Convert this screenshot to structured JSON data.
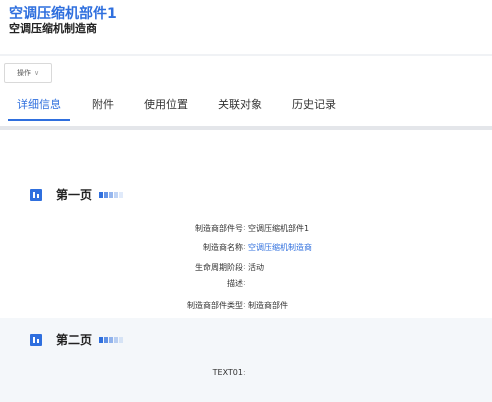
{
  "header": {
    "title": "空调压缩机部件1",
    "subtitle": "空调压缩机制造商"
  },
  "toolbar": {
    "ops_label": "操作",
    "ops_chevron": "∨"
  },
  "tabs": [
    {
      "label": "详细信息",
      "active": true
    },
    {
      "label": "附件"
    },
    {
      "label": "使用位置"
    },
    {
      "label": "关联对象"
    },
    {
      "label": "历史记录"
    }
  ],
  "sections": [
    {
      "title": "第一页",
      "fields": [
        {
          "label": "制造商部件号",
          "value": "空调压缩机部件1"
        },
        {
          "label": "制造商名称",
          "value": "空调压缩机制造商"
        },
        {
          "label": "生命周期阶段",
          "value": "活动"
        },
        {
          "label": "描述",
          "value": ""
        },
        {
          "label": "制造商部件类型",
          "value": "制造商部件"
        }
      ]
    },
    {
      "title": "第二页",
      "fields": [
        {
          "label": "TEXT01",
          "value": ""
        }
      ]
    }
  ],
  "colors": {
    "accent": "#2f6fde",
    "link": "#2f6fde"
  },
  "icons": {
    "section": "chart-bar-icon",
    "dropdown": "chevron-down-icon"
  }
}
